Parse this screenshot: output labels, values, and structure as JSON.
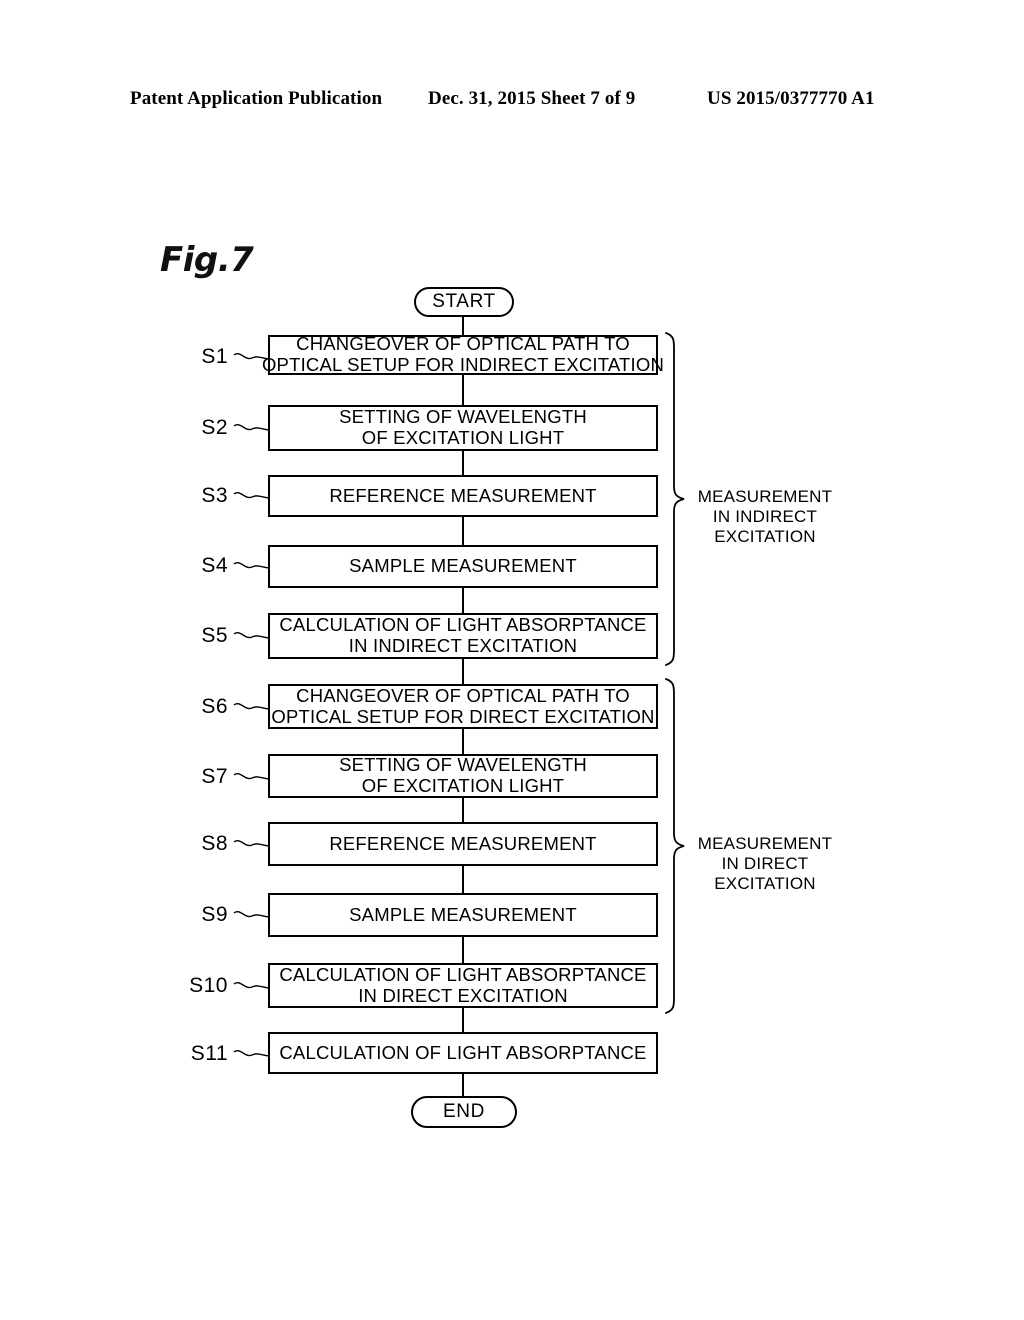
{
  "header": {
    "left": "Patent Application Publication",
    "middle": "Dec. 31, 2015  Sheet 7 of 9",
    "right": "US 2015/0377770 A1"
  },
  "figure": {
    "label": "Fig.7"
  },
  "flowchart": {
    "start": {
      "label": "START"
    },
    "end": {
      "label": "END"
    },
    "steps": [
      {
        "id": "S1",
        "lines": [
          "CHANGEOVER OF OPTICAL PATH TO",
          "OPTICAL SETUP FOR INDIRECT EXCITATION"
        ]
      },
      {
        "id": "S2",
        "lines": [
          "SETTING OF WAVELENGTH",
          "OF EXCITATION LIGHT"
        ]
      },
      {
        "id": "S3",
        "lines": [
          "REFERENCE MEASUREMENT"
        ]
      },
      {
        "id": "S4",
        "lines": [
          "SAMPLE MEASUREMENT"
        ]
      },
      {
        "id": "S5",
        "lines": [
          "CALCULATION OF LIGHT ABSORPTANCE",
          "IN INDIRECT EXCITATION"
        ]
      },
      {
        "id": "S6",
        "lines": [
          "CHANGEOVER OF OPTICAL PATH TO",
          "OPTICAL SETUP FOR DIRECT EXCITATION"
        ]
      },
      {
        "id": "S7",
        "lines": [
          "SETTING OF WAVELENGTH",
          "OF EXCITATION LIGHT"
        ]
      },
      {
        "id": "S8",
        "lines": [
          "REFERENCE MEASUREMENT"
        ]
      },
      {
        "id": "S9",
        "lines": [
          "SAMPLE MEASUREMENT"
        ]
      },
      {
        "id": "S10",
        "lines": [
          "CALCULATION OF LIGHT ABSORPTANCE",
          "IN DIRECT EXCITATION"
        ]
      },
      {
        "id": "S11",
        "lines": [
          "CALCULATION OF LIGHT ABSORPTANCE"
        ]
      }
    ],
    "groups": [
      {
        "name": "indirect-excitation-group",
        "lines": [
          "MEASUREMENT",
          "IN INDIRECT",
          "EXCITATION"
        ],
        "covers": [
          "S1",
          "S2",
          "S3",
          "S4",
          "S5"
        ]
      },
      {
        "name": "direct-excitation-group",
        "lines": [
          "MEASUREMENT",
          "IN DIRECT",
          "EXCITATION"
        ],
        "covers": [
          "S6",
          "S7",
          "S8",
          "S9",
          "S10"
        ]
      }
    ]
  },
  "colors": {
    "ink": "#000000",
    "paper": "#ffffff"
  }
}
